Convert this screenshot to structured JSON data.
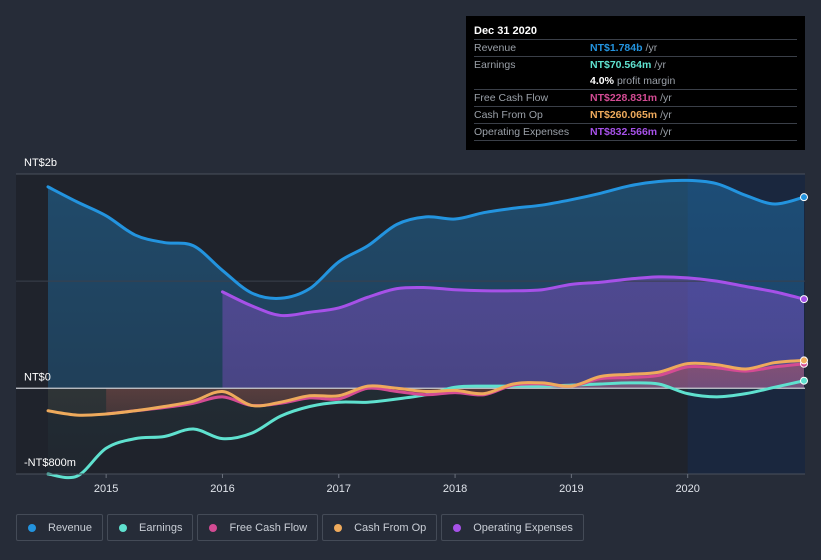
{
  "tooltip": {
    "date": "Dec 31 2020",
    "rows": [
      {
        "label": "Revenue",
        "value": "NT$1.784b",
        "unit": "/yr",
        "color": "#2394df"
      },
      {
        "label": "Earnings",
        "value": "NT$70.564m",
        "unit": "/yr",
        "color": "#5fe1cf"
      },
      {
        "label": "",
        "value": "4.0%",
        "unit": "profit margin",
        "color": "#ffffff"
      },
      {
        "label": "Free Cash Flow",
        "value": "NT$228.831m",
        "unit": "/yr",
        "color": "#d34b93"
      },
      {
        "label": "Cash From Op",
        "value": "NT$260.065m",
        "unit": "/yr",
        "color": "#eeaa5c"
      },
      {
        "label": "Operating Expenses",
        "value": "NT$832.566m",
        "unit": "/yr",
        "color": "#a651e8"
      }
    ]
  },
  "legend": [
    {
      "label": "Revenue",
      "color": "#2394df"
    },
    {
      "label": "Earnings",
      "color": "#5fe1cf"
    },
    {
      "label": "Free Cash Flow",
      "color": "#d34b93"
    },
    {
      "label": "Cash From Op",
      "color": "#eeaa5c"
    },
    {
      "label": "Operating Expenses",
      "color": "#a651e8"
    }
  ],
  "chart_data": {
    "type": "area",
    "title": "",
    "xlabel": "",
    "ylabel": "",
    "ylim": [
      -800,
      2000
    ],
    "xlim": [
      2014.5,
      2021.0
    ],
    "y_tick_labels": [
      {
        "value": 2000,
        "label": "NT$2b"
      },
      {
        "value": 0,
        "label": "NT$0"
      },
      {
        "value": -800,
        "label": "-NT$800m"
      }
    ],
    "x_tick_labels": [
      {
        "value": 2015,
        "label": "2015"
      },
      {
        "value": 2016,
        "label": "2016"
      },
      {
        "value": 2017,
        "label": "2017"
      },
      {
        "value": 2018,
        "label": "2018"
      },
      {
        "value": 2019,
        "label": "2019"
      },
      {
        "value": 2020,
        "label": "2020"
      }
    ],
    "highlight_start": 2020.0,
    "units": "NT$ millions",
    "series": [
      {
        "name": "Revenue",
        "color": "#2394df",
        "x": [
          2014.5,
          2014.75,
          2015.0,
          2015.25,
          2015.5,
          2015.75,
          2016.0,
          2016.25,
          2016.5,
          2016.75,
          2017.0,
          2017.25,
          2017.5,
          2017.75,
          2018.0,
          2018.25,
          2018.5,
          2018.75,
          2019.0,
          2019.25,
          2019.5,
          2019.75,
          2020.0,
          2020.25,
          2020.5,
          2020.75,
          2021.0
        ],
        "values": [
          1880,
          1740,
          1610,
          1430,
          1360,
          1330,
          1100,
          890,
          840,
          930,
          1180,
          1330,
          1530,
          1600,
          1580,
          1640,
          1680,
          1710,
          1760,
          1820,
          1890,
          1930,
          1940,
          1910,
          1800,
          1720,
          1784
        ]
      },
      {
        "name": "Earnings",
        "color": "#5fe1cf",
        "x": [
          2014.5,
          2014.75,
          2015.0,
          2015.25,
          2015.5,
          2015.75,
          2016.0,
          2016.25,
          2016.5,
          2016.75,
          2017.0,
          2017.25,
          2017.5,
          2017.75,
          2018.0,
          2018.25,
          2018.5,
          2018.75,
          2019.0,
          2019.25,
          2019.5,
          2019.75,
          2020.0,
          2020.25,
          2020.5,
          2020.75,
          2021.0
        ],
        "values": [
          -800,
          -820,
          -560,
          -470,
          -450,
          -380,
          -470,
          -420,
          -260,
          -170,
          -130,
          -130,
          -100,
          -60,
          10,
          20,
          20,
          20,
          30,
          40,
          50,
          40,
          -50,
          -80,
          -50,
          10,
          70.564
        ]
      },
      {
        "name": "Free Cash Flow",
        "color": "#d34b93",
        "x": [
          2015.0,
          2015.25,
          2015.5,
          2015.75,
          2016.0,
          2016.25,
          2016.5,
          2016.75,
          2017.0,
          2017.25,
          2017.5,
          2017.75,
          2018.0,
          2018.25,
          2018.5,
          2018.75,
          2019.0,
          2019.25,
          2019.5,
          2019.75,
          2020.0,
          2020.25,
          2020.5,
          2020.75,
          2021.0
        ],
        "values": [
          -240,
          -210,
          -180,
          -140,
          -80,
          -160,
          -140,
          -90,
          -100,
          0,
          -30,
          -60,
          -40,
          -60,
          30,
          40,
          20,
          90,
          100,
          120,
          200,
          190,
          160,
          200,
          228.831
        ]
      },
      {
        "name": "Cash From Op",
        "color": "#eeaa5c",
        "x": [
          2014.5,
          2014.75,
          2015.0,
          2015.25,
          2015.5,
          2015.75,
          2016.0,
          2016.25,
          2016.5,
          2016.75,
          2017.0,
          2017.25,
          2017.5,
          2017.75,
          2018.0,
          2018.25,
          2018.5,
          2018.75,
          2019.0,
          2019.25,
          2019.5,
          2019.75,
          2020.0,
          2020.25,
          2020.5,
          2020.75,
          2021.0
        ],
        "values": [
          -210,
          -250,
          -240,
          -210,
          -170,
          -120,
          -30,
          -160,
          -130,
          -70,
          -70,
          20,
          0,
          -30,
          -20,
          -50,
          40,
          50,
          20,
          110,
          130,
          150,
          230,
          220,
          180,
          240,
          260.065
        ]
      },
      {
        "name": "Operating Expenses",
        "color": "#a651e8",
        "x": [
          2016.0,
          2016.25,
          2016.5,
          2016.75,
          2017.0,
          2017.25,
          2017.5,
          2017.75,
          2018.0,
          2018.25,
          2018.5,
          2018.75,
          2019.0,
          2019.25,
          2019.5,
          2019.75,
          2020.0,
          2020.25,
          2020.5,
          2020.75,
          2021.0
        ],
        "values": [
          900,
          770,
          680,
          710,
          750,
          850,
          930,
          940,
          920,
          910,
          910,
          920,
          970,
          990,
          1020,
          1040,
          1030,
          1000,
          950,
          900,
          832.566
        ]
      }
    ]
  }
}
